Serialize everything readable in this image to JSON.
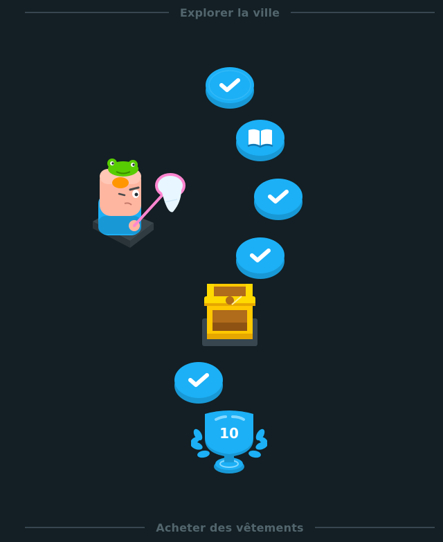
{
  "sections": {
    "top_title": "Explorer la ville",
    "bottom_title": "Acheter des vêtements"
  },
  "path": {
    "nodes": [
      {
        "type": "completed-lesson",
        "icon": "check-icon"
      },
      {
        "type": "story-lesson",
        "icon": "book-icon"
      },
      {
        "type": "completed-lesson",
        "icon": "check-icon"
      },
      {
        "type": "completed-lesson",
        "icon": "check-icon"
      },
      {
        "type": "chest-reward",
        "icon": "treasure-chest-icon"
      },
      {
        "type": "completed-lesson",
        "icon": "check-icon"
      },
      {
        "type": "unit-trophy",
        "icon": "trophy-icon",
        "level": "10"
      }
    ]
  },
  "colors": {
    "background": "#131f24",
    "node_blue": "#1cb0f6",
    "node_blue_dark": "#1899d6",
    "divider_text": "#52656d",
    "divider_line": "#37464f",
    "chest_gold": "#ffc800"
  }
}
